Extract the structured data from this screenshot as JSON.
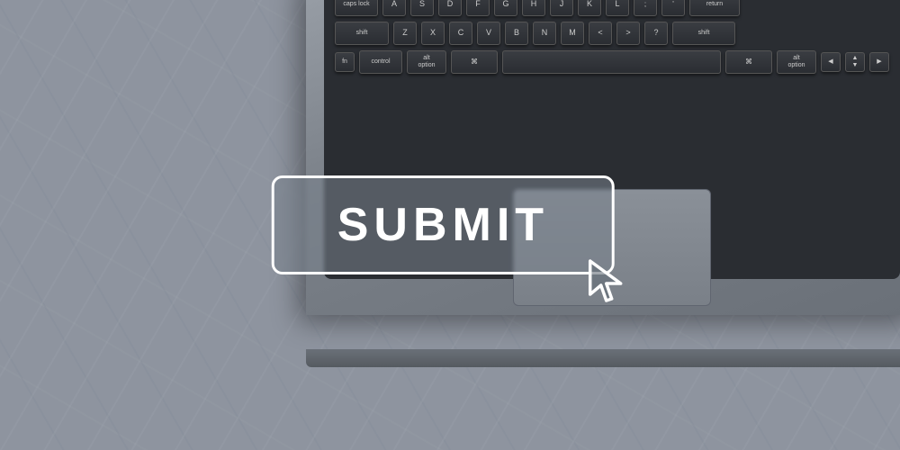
{
  "scene": {
    "background_color": "#b0b8c4",
    "overlay_color": "rgba(70,80,95,0.45)"
  },
  "submit_button": {
    "label": "SUBMIT",
    "border_color": "#ffffff",
    "text_color": "#ffffff"
  },
  "keyboard": {
    "rows": [
      {
        "keys": [
          {
            "label": "caps lock",
            "wide": true
          },
          {
            "label": "A"
          },
          {
            "label": "S"
          },
          {
            "label": "D"
          },
          {
            "label": "F"
          },
          {
            "label": "G"
          },
          {
            "label": "H"
          },
          {
            "label": "J"
          },
          {
            "label": "K"
          },
          {
            "label": "L"
          },
          {
            "label": "; :"
          },
          {
            "label": "' \""
          },
          {
            "label": "return",
            "wide": true
          }
        ]
      },
      {
        "keys": [
          {
            "label": "shift",
            "wide": true
          },
          {
            "label": "Z"
          },
          {
            "label": "X"
          },
          {
            "label": "C"
          },
          {
            "label": "V"
          },
          {
            "label": "B"
          },
          {
            "label": "N"
          },
          {
            "label": "M"
          },
          {
            "label": ", <"
          },
          {
            "label": ". >"
          },
          {
            "label": "/ ?"
          },
          {
            "label": "shift",
            "wide": true
          }
        ]
      },
      {
        "keys": [
          {
            "label": "fn"
          },
          {
            "label": "control",
            "wide": true
          },
          {
            "label": "alt option"
          },
          {
            "label": "⌘",
            "wider": true
          },
          {
            "label": "",
            "space": true
          },
          {
            "label": "⌘",
            "wider": true
          },
          {
            "label": "alt option"
          },
          {
            "label": "◀"
          },
          {
            "label": "▲▼"
          },
          {
            "label": "▶"
          }
        ]
      }
    ]
  },
  "cursor": {
    "icon": "cursor-click-icon"
  }
}
